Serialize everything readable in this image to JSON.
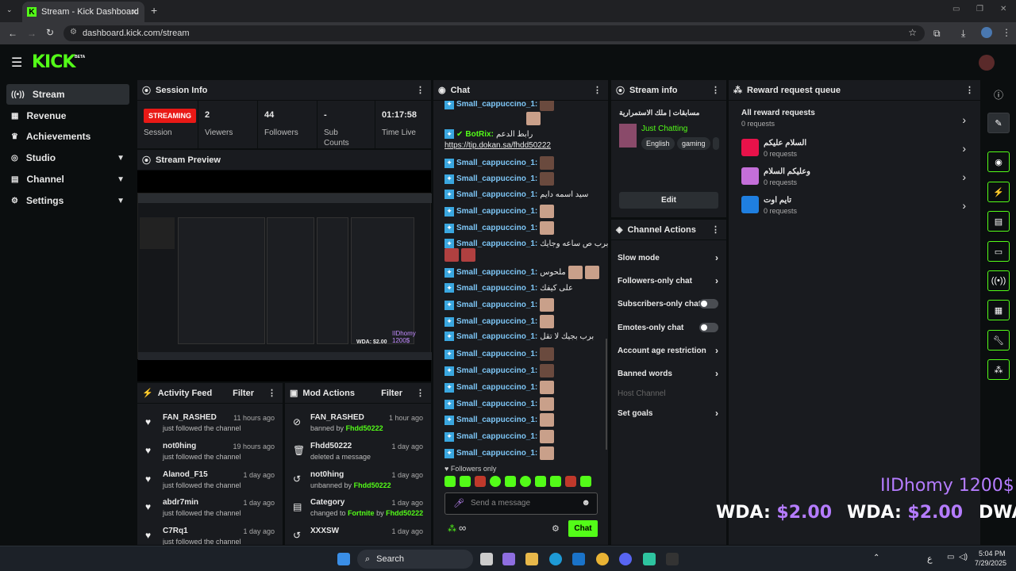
{
  "browser": {
    "tab_title": "Stream - Kick Dashboard",
    "url": "dashboard.kick.com/stream"
  },
  "header": {
    "logo": "KICK",
    "logo_tag": "BETA"
  },
  "sidebar": {
    "items": [
      {
        "label": "Stream",
        "icon": "broadcast-icon"
      },
      {
        "label": "Revenue",
        "icon": "revenue-icon"
      },
      {
        "label": "Achievements",
        "icon": "trophy-icon"
      },
      {
        "label": "Studio",
        "icon": "studio-icon"
      },
      {
        "label": "Channel",
        "icon": "channel-icon"
      },
      {
        "label": "Settings",
        "icon": "gear-icon"
      }
    ]
  },
  "session": {
    "title": "Session Info",
    "status": "STREAMING",
    "status_label": "Session",
    "stats": [
      {
        "value": "2",
        "label": "Viewers"
      },
      {
        "value": "44",
        "label": "Followers"
      },
      {
        "value": "-",
        "label": "Sub Counts"
      },
      {
        "value": "01:17:58",
        "label": "Time Live"
      }
    ]
  },
  "preview": {
    "title": "Stream Preview",
    "overlay1": "IIDhomy 1200$",
    "overlay2": "WDA: $2.00"
  },
  "activity": {
    "title": "Activity Feed",
    "filter": "Filter",
    "items": [
      {
        "name": "FAN_RASHED",
        "sub": "just followed the channel",
        "time": "11 hours ago"
      },
      {
        "name": "not0hing",
        "sub": "just followed the channel",
        "time": "19 hours ago"
      },
      {
        "name": "Alanod_F15",
        "sub": "just followed the channel",
        "time": "1 day ago"
      },
      {
        "name": "abdr7min",
        "sub": "just followed the channel",
        "time": "1 day ago"
      },
      {
        "name": "C7Rq1",
        "sub": "just followed the channel",
        "time": "1 day ago"
      }
    ]
  },
  "mod": {
    "title": "Mod Actions",
    "filter": "Filter",
    "items": [
      {
        "name": "FAN_RASHED",
        "sub_pre": "banned by",
        "sub_user": "Fhdd50222",
        "time": "1 hour ago"
      },
      {
        "name": "Fhdd50222",
        "sub_pre": "deleted a message",
        "sub_user": "",
        "time": "1 day ago"
      },
      {
        "name": "not0hing",
        "sub_pre": "unbanned by",
        "sub_user": "Fhdd50222",
        "time": "1 day ago"
      },
      {
        "name": "Category",
        "sub_pre": "changed to",
        "sub_user": "Fortnite",
        "sub_post": "by",
        "sub_user2": "Fhdd50222",
        "time": "1 day ago"
      },
      {
        "name": "XXXSW",
        "sub_pre": "",
        "sub_user": "",
        "time": "1 day ago"
      }
    ]
  },
  "chat": {
    "title": "Chat",
    "bot_name": "BotRix:",
    "bot_msg": "رابط الدعم",
    "bot_link": "https://tip.dokan.sa/fhdd50222",
    "user": "Small_cappuccino_1:",
    "msgs": {
      "m1": "سيد اسمه دايم",
      "m2": "برب ص ساعه وجايك",
      "m3": "ملحوس",
      "m4": "على كيفك",
      "m5": "برب بجيك لا تقل"
    },
    "followers_only": "Followers only",
    "placeholder": "Send a message",
    "send": "Chat"
  },
  "streaminfo": {
    "title": "Stream info",
    "stream_title": "مسابقات | ملك الاستمرارية",
    "category": "Just Chatting",
    "tags": [
      "English",
      "gaming"
    ],
    "edit": "Edit"
  },
  "actions": {
    "title": "Channel Actions",
    "items": [
      "Slow mode",
      "Followers-only chat",
      "Subscribers-only chat",
      "Emotes-only chat",
      "Account age restriction",
      "Banned words",
      "Host Channel",
      "Set goals"
    ]
  },
  "rewards": {
    "title": "Reward request queue",
    "all": "All reward requests",
    "all_count": "0 requests",
    "items": [
      {
        "name": "السلام عليكم",
        "count": "0 requests",
        "color": "#e8124a"
      },
      {
        "name": "وعليكم السلام",
        "count": "0 requests",
        "color": "#c46fd9"
      },
      {
        "name": "تايم اوت",
        "count": "0 requests",
        "color": "#1f7fe0"
      }
    ]
  },
  "taskbar": {
    "search": "Search",
    "time": "5:04 PM",
    "date": "7/29/2025",
    "lang": "ع"
  }
}
